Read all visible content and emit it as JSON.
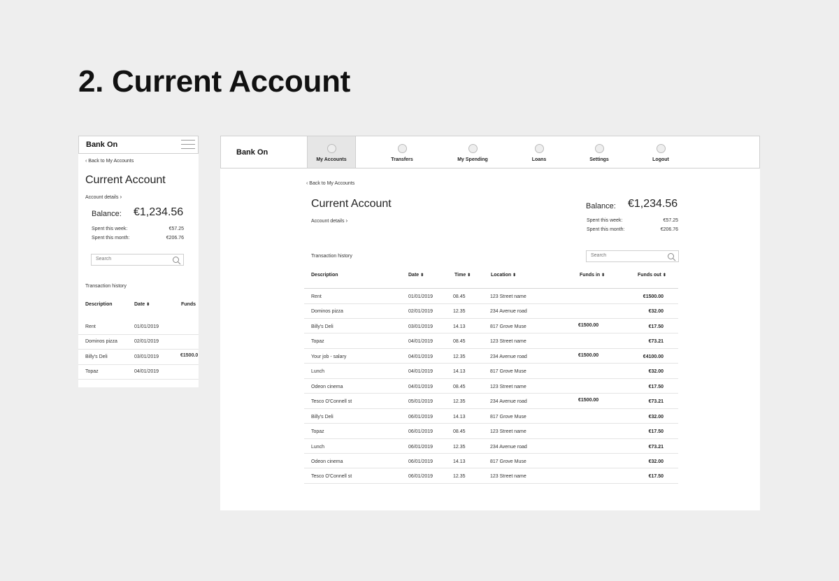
{
  "page": {
    "title": "2. Current Account"
  },
  "brand": "Bank On",
  "back_label": "Back to My Accounts",
  "account": {
    "title": "Current Account",
    "details_label": "Account details",
    "balance_label": "Balance:",
    "balance_value": "€1,234.56",
    "spent_week_label": "Spent this week:",
    "spent_week_value": "€57.25",
    "spent_month_label": "Spent this month:",
    "spent_month_value": "€206.76"
  },
  "search": {
    "placeholder": "Search"
  },
  "transactions_label": "Transaction history",
  "nav": [
    {
      "label": "My Accounts",
      "active": true
    },
    {
      "label": "Transfers"
    },
    {
      "label": "My Spending"
    },
    {
      "label": "Loans"
    },
    {
      "label": "Settings"
    },
    {
      "label": "Logout"
    }
  ],
  "columns": {
    "description": "Description",
    "date": "Date",
    "time": "Time",
    "location": "Location",
    "funds_in": "Funds in",
    "funds_out": "Funds out",
    "funds_truncated": "Funds"
  },
  "mobile_rows": [
    {
      "desc": "Rent",
      "date": "01/01/2019",
      "funds": ""
    },
    {
      "desc": "Dominos pizza",
      "date": "02/01/2019",
      "funds": ""
    },
    {
      "desc": "Billy's Deli",
      "date": "03/01/2019",
      "funds": "€1500.0"
    },
    {
      "desc": "Topaz",
      "date": "04/01/2019",
      "funds": ""
    }
  ],
  "rows": [
    {
      "desc": "Rent",
      "date": "01/01/2019",
      "time": "08.45",
      "loc": "123 Street name",
      "in": "",
      "out": "€1500.00"
    },
    {
      "desc": "Dominos pizza",
      "date": "02/01/2019",
      "time": "12.35",
      "loc": "234 Avenue road",
      "in": "",
      "out": "€32.00"
    },
    {
      "desc": "Billy's Deli",
      "date": "03/01/2019",
      "time": "14.13",
      "loc": "817 Grove Muse",
      "in": "€1500.00",
      "out": "€17.50"
    },
    {
      "desc": "Topaz",
      "date": "04/01/2019",
      "time": "08.45",
      "loc": "123 Street name",
      "in": "",
      "out": "€73.21"
    },
    {
      "desc": "Your job - salary",
      "date": "04/01/2019",
      "time": "12.35",
      "loc": "234 Avenue road",
      "in": "€1500.00",
      "out": "€4100.00"
    },
    {
      "desc": "Lunch",
      "date": "04/01/2019",
      "time": "14.13",
      "loc": "817 Grove Muse",
      "in": "",
      "out": "€32.00"
    },
    {
      "desc": "Odeon cinema",
      "date": "04/01/2019",
      "time": "08.45",
      "loc": "123 Street name",
      "in": "",
      "out": "€17.50"
    },
    {
      "desc": "Tesco O'Connell st",
      "date": "05/01/2019",
      "time": "12.35",
      "loc": "234 Avenue road",
      "in": "€1500.00",
      "out": "€73.21"
    },
    {
      "desc": "Billy's Deli",
      "date": "06/01/2019",
      "time": "14.13",
      "loc": "817 Grove Muse",
      "in": "",
      "out": "€32.00"
    },
    {
      "desc": "Topaz",
      "date": "06/01/2019",
      "time": "08.45",
      "loc": "123 Street name",
      "in": "",
      "out": "€17.50"
    },
    {
      "desc": "Lunch",
      "date": "06/01/2019",
      "time": "12.35",
      "loc": "234 Avenue road",
      "in": "",
      "out": "€73.21"
    },
    {
      "desc": "Odeon cinema",
      "date": "06/01/2019",
      "time": "14.13",
      "loc": "817 Grove Muse",
      "in": "",
      "out": "€32.00"
    },
    {
      "desc": "Tesco O'Connell st",
      "date": "06/01/2019",
      "time": "12.35",
      "loc": "123 Street name",
      "in": "",
      "out": "€17.50"
    }
  ]
}
